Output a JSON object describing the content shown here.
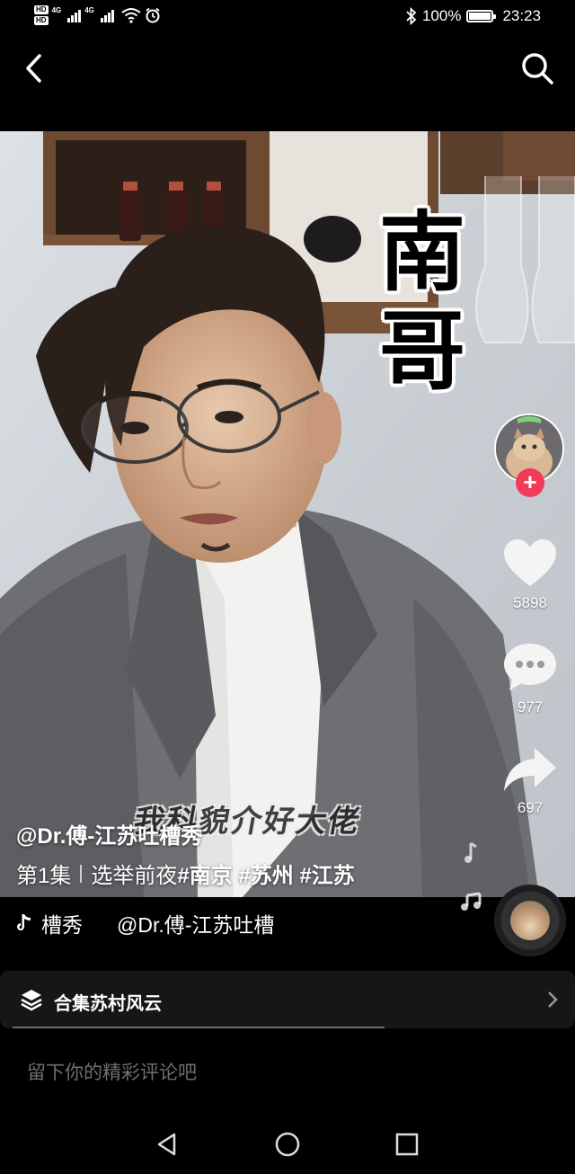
{
  "status_bar": {
    "hd1": "HD",
    "hd2": "HD",
    "sig1_label": "4G",
    "sig2_label": "4G",
    "battery": "100%",
    "time": "23:23",
    "icons": [
      "hd-icon",
      "signal-icon",
      "wifi-icon",
      "alarm-icon",
      "bluetooth-icon",
      "battery-icon"
    ]
  },
  "nav": {
    "back_icon": "chevron-left-icon",
    "search_icon": "search-icon"
  },
  "video": {
    "overlay_text": [
      "南",
      "哥"
    ],
    "subtitle": "我科貌介好大佬"
  },
  "actions": {
    "likes": "5898",
    "comments": "977",
    "shares": "697",
    "follow": "+"
  },
  "caption": {
    "author": "@Dr.傅-江苏吐槽秀",
    "episode": "第1集",
    "text": "选举前夜",
    "tags": "#南京 #苏州 #江苏"
  },
  "music": {
    "name": "槽秀",
    "credit": "@Dr.傅-江苏吐槽"
  },
  "collection": {
    "label": "合集苏村风云"
  },
  "comment_input": {
    "placeholder": "留下你的精彩评论吧"
  },
  "colors": {
    "follow_red": "#f23b5a",
    "background": "#000000"
  }
}
